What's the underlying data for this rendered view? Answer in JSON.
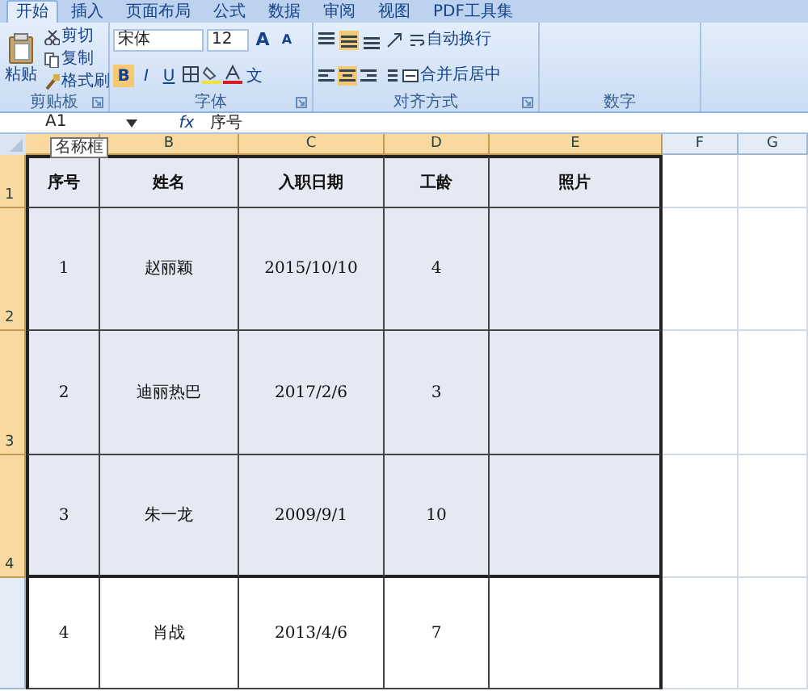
{
  "tabs": [
    {
      "label": "开始",
      "selected": true
    },
    {
      "label": "插入",
      "selected": false
    },
    {
      "label": "页面布局",
      "selected": false
    },
    {
      "label": "公式",
      "selected": false
    },
    {
      "label": "数据",
      "selected": false
    },
    {
      "label": "审阅",
      "selected": false
    },
    {
      "label": "视图",
      "selected": false
    },
    {
      "label": "PDF工具集",
      "selected": false
    }
  ],
  "clipboard": {
    "paste": "粘贴",
    "buttons": [
      "剪切",
      "复制",
      "格式刷"
    ],
    "label": "剪贴板"
  },
  "font": {
    "name": "宋体",
    "size": "12",
    "size_buttons": [
      "A",
      "A"
    ],
    "style_buttons": [
      "B",
      "I",
      "U"
    ],
    "phonetic": "文",
    "label": "字体"
  },
  "alignment": {
    "buttons": [
      "自动换行",
      "合并后居中"
    ],
    "label": "对齐方式"
  },
  "number": {
    "label": "数字"
  },
  "formula_bar": {
    "name_box": "A1",
    "fx": "fx",
    "content": "序号"
  },
  "tooltip": "名称框",
  "sheet": {
    "columns": [
      {
        "selected": true
      },
      {
        "label": "B",
        "selected": true
      },
      {
        "label": "C",
        "selected": true
      },
      {
        "label": "D",
        "selected": true
      },
      {
        "label": "E",
        "selected": true
      },
      {
        "label": "F",
        "selected": false
      },
      {
        "label": "G",
        "selected": false
      }
    ],
    "rows": [
      {
        "number": "1",
        "kind": "heading",
        "selected": true,
        "cells": [
          "序号",
          "姓名",
          "入职日期",
          "工龄",
          "照片"
        ]
      },
      {
        "number": "2",
        "kind": "data",
        "selected": true,
        "cells": [
          "1",
          "赵丽颖",
          "2015/10/10",
          "4",
          ""
        ]
      },
      {
        "number": "3",
        "kind": "data",
        "selected": true,
        "cells": [
          "2",
          "迪丽热巴",
          "2017/2/6",
          "3",
          ""
        ]
      },
      {
        "number": "4",
        "kind": "data",
        "selected": true,
        "cells": [
          "3",
          "朱一龙",
          "2009/9/1",
          "10",
          ""
        ]
      },
      {
        "kind": "data",
        "selected": false,
        "cells": [
          "4",
          "肖战",
          "2013/4/6",
          "7",
          ""
        ]
      }
    ]
  }
}
